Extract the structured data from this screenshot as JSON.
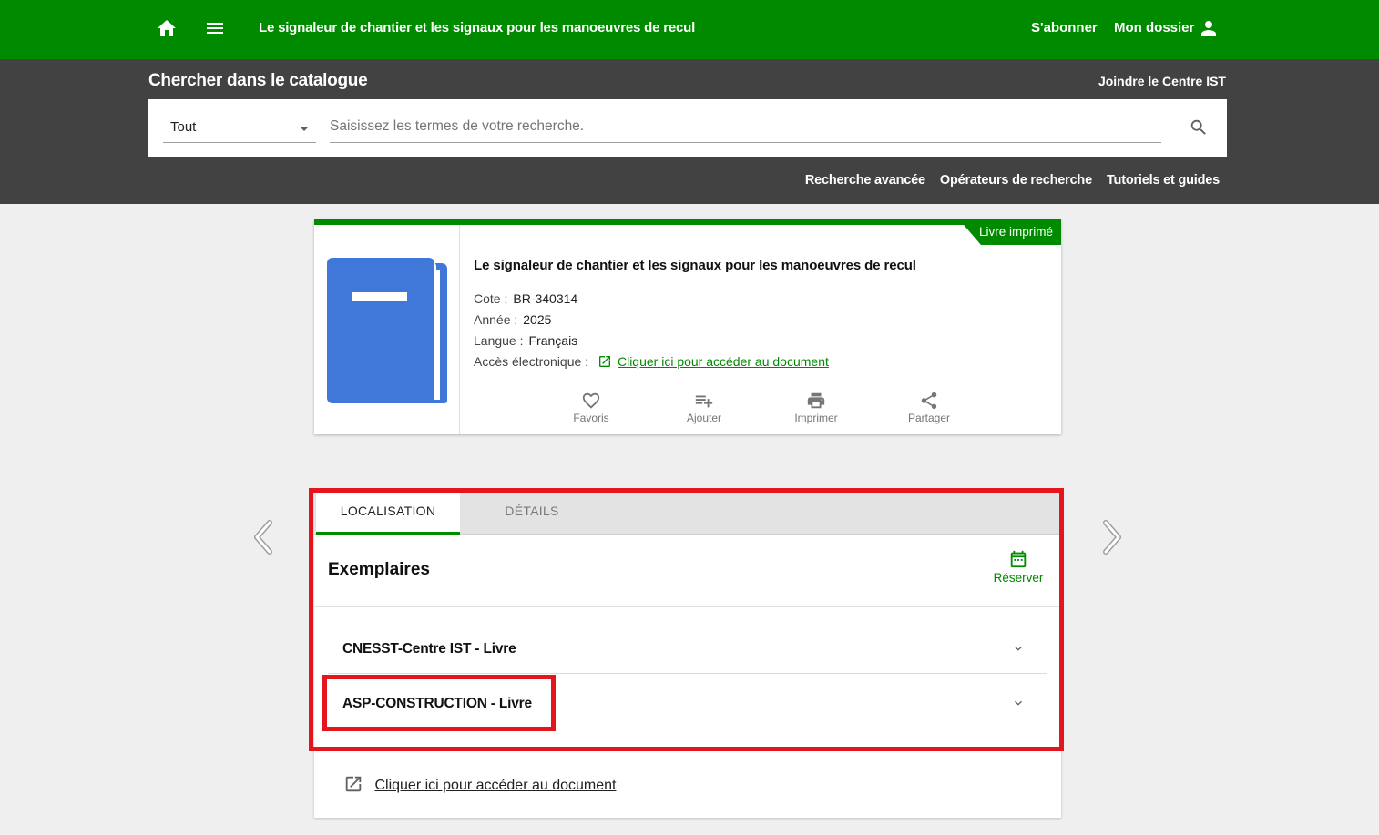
{
  "topbar": {
    "title": "Le signaleur de chantier et les signaux pour les manoeuvres de recul",
    "subscribe": "S'abonner",
    "dossier": "Mon dossier"
  },
  "search": {
    "heading": "Chercher dans le catalogue",
    "join": "Joindre le Centre IST",
    "scope_value": "Tout",
    "placeholder": "Saisissez les termes de votre recherche.",
    "links": [
      "Recherche avancée",
      "Opérateurs de recherche",
      "Tutoriels et guides"
    ]
  },
  "record": {
    "badge": "Livre imprimé",
    "title": "Le signaleur de chantier et les signaux pour les manoeuvres de recul",
    "cote_label": "Cote :",
    "cote": "BR-340314",
    "annee_label": "Année :",
    "annee": "2025",
    "langue_label": "Langue :",
    "langue": "Français",
    "acces_label": "Accès électronique :",
    "acces_link": "Cliquer ici pour accéder au document",
    "actions": {
      "favoris": "Favoris",
      "ajouter": "Ajouter",
      "imprimer": "Imprimer",
      "partager": "Partager"
    }
  },
  "panel": {
    "tabs": [
      "LOCALISATION",
      "DÉTAILS"
    ],
    "heading": "Exemplaires",
    "reserve": "Réserver",
    "holdings": [
      "CNESST-Centre IST - Livre",
      "ASP-CONSTRUCTION - Livre"
    ],
    "bottom_link": "Cliquer ici pour accéder au document"
  },
  "colors": {
    "brand_green": "#008a00",
    "search_band": "#424242",
    "highlight_red": "#e3161d",
    "book_blue": "#3f78d8"
  },
  "icons": [
    "home-icon",
    "menu-icon",
    "person-icon",
    "search-icon",
    "book-icon",
    "external-link-icon",
    "heart-icon",
    "playlist-add-icon",
    "print-icon",
    "share-icon",
    "calendar-icon",
    "chevron-down-icon",
    "chevron-left-icon",
    "chevron-right-icon"
  ]
}
